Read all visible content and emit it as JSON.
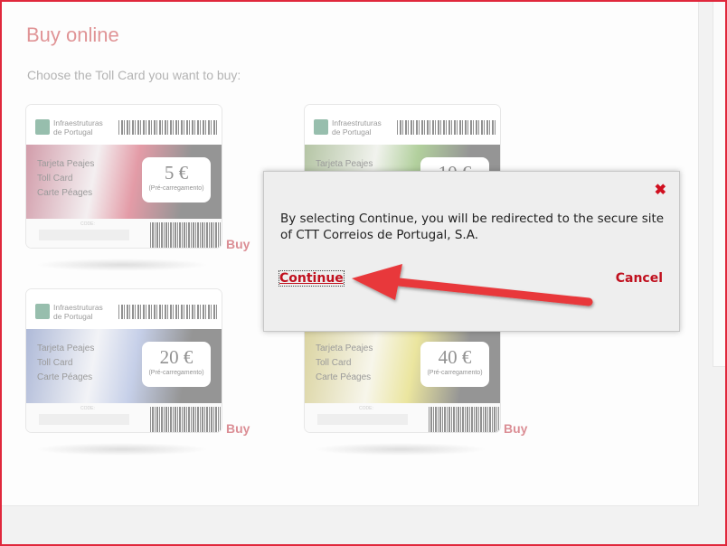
{
  "page": {
    "title": "Buy online",
    "subtitle": "Choose the Toll Card you want to buy:"
  },
  "cards": [
    {
      "price": "5 €",
      "theme": "red"
    },
    {
      "price": "10 €",
      "theme": "green"
    },
    {
      "price": "20 €",
      "theme": "blue"
    },
    {
      "price": "40 €",
      "theme": "yellow"
    }
  ],
  "card_common": {
    "brand_line1": "Infraestruturas",
    "brand_line2": "de Portugal",
    "line1": "Tarjeta Peajes",
    "line2": "Toll Card",
    "line3": "Carte Péages",
    "preload": "(Pré-carregamento)",
    "code_label": "CODE:"
  },
  "buy_label": "Buy",
  "modal": {
    "message": "By selecting Continue, you will be redirected to the secure site of CTT Correios de Portugal, S.A.",
    "continue_label": "Continue",
    "cancel_label": "Cancel",
    "close_symbol": "✖"
  },
  "colors": {
    "accent": "#c0282d",
    "arrow": "#e8383b"
  }
}
